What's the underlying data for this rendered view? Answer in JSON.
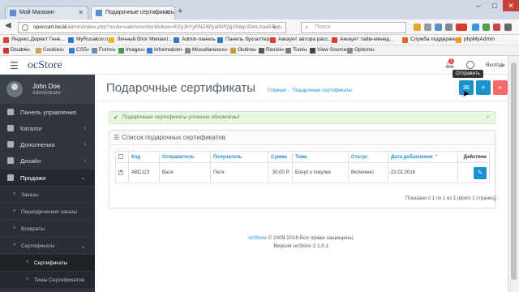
{
  "browser": {
    "tabs": [
      {
        "title": "Мой Магазин",
        "active": false
      },
      {
        "title": "Подарочные сертификаты",
        "active": true
      }
    ],
    "url_host": "opencart.local/",
    "url_path": "admin/index.php?route=sale/voucher&token=KXyJhYyPNZ4Pyal9PQgX58gUDeluXaeEPy",
    "search_placeholder": "Поиск",
    "bookmarks": [
      "Яндекс.Директ Гене...",
      "MyRusakov.ru",
      "Личный блог Михаил...",
      "Admin-панель",
      "Панель бухгалтера",
      "Аккаунт автора расс...",
      "Аккаунт тайм-менед...",
      "Служба поддержки",
      "phpMyAdmin"
    ],
    "webdev_toolbar": [
      "Disable",
      "Cookies",
      "CSS",
      "Forms",
      "Images",
      "Information",
      "Miscellaneous",
      "Outline",
      "Resize",
      "Tools",
      "View Source",
      "Options"
    ]
  },
  "header": {
    "brand": "ocStore",
    "notification_count": "1",
    "logout_label": "Выход"
  },
  "sidebar": {
    "user_name": "John Doe",
    "user_role": "Administrator",
    "items": [
      {
        "label": "Панель управления"
      },
      {
        "label": "Каталог"
      },
      {
        "label": "Дополнения"
      },
      {
        "label": "Дизайн"
      },
      {
        "label": "Продажи"
      }
    ],
    "sub_items": [
      {
        "label": "Заказы"
      },
      {
        "label": "Периодические заказы"
      },
      {
        "label": "Возвраты"
      },
      {
        "label": "Сертификаты"
      },
      {
        "label": "Сертификаты"
      },
      {
        "label": "Темы Сертификатов"
      }
    ]
  },
  "main": {
    "title": "Подарочные сертификаты",
    "breadcrumb_home": "Главная",
    "breadcrumb_current": "Подарочные сертификаты",
    "tooltip": "Отправить",
    "alert_text": "Подарочные сертификаты успешно обновлены!",
    "panel_title": "Список подарочных сертификатов",
    "columns": {
      "code": "Код",
      "from": "Отправитель",
      "to": "Получатель",
      "amount": "Сумма",
      "theme": "Тема",
      "status": "Статус",
      "date_added": "Дата добавления",
      "action": "Действие"
    },
    "rows": [
      {
        "code": "ABC123",
        "from": "Вася",
        "to": "Петя",
        "amount": "30.00 Р.",
        "theme": "Бонус к покупке",
        "status": "Включено",
        "date_added": "22.01.2016"
      }
    ],
    "pagination_info": "Показано с 1 по 1 из 1 (всего 1 страниц)"
  },
  "footer": {
    "brand_link": "ocStore",
    "copyright": "© 2009-2016 Все права защищены.",
    "version": "Версия ocStore 2.1.0.1"
  },
  "colors": {
    "accent": "#1e91cf",
    "danger": "#f56b6b",
    "sidebar": "#31353d",
    "success_bg": "#eaf5e3"
  }
}
